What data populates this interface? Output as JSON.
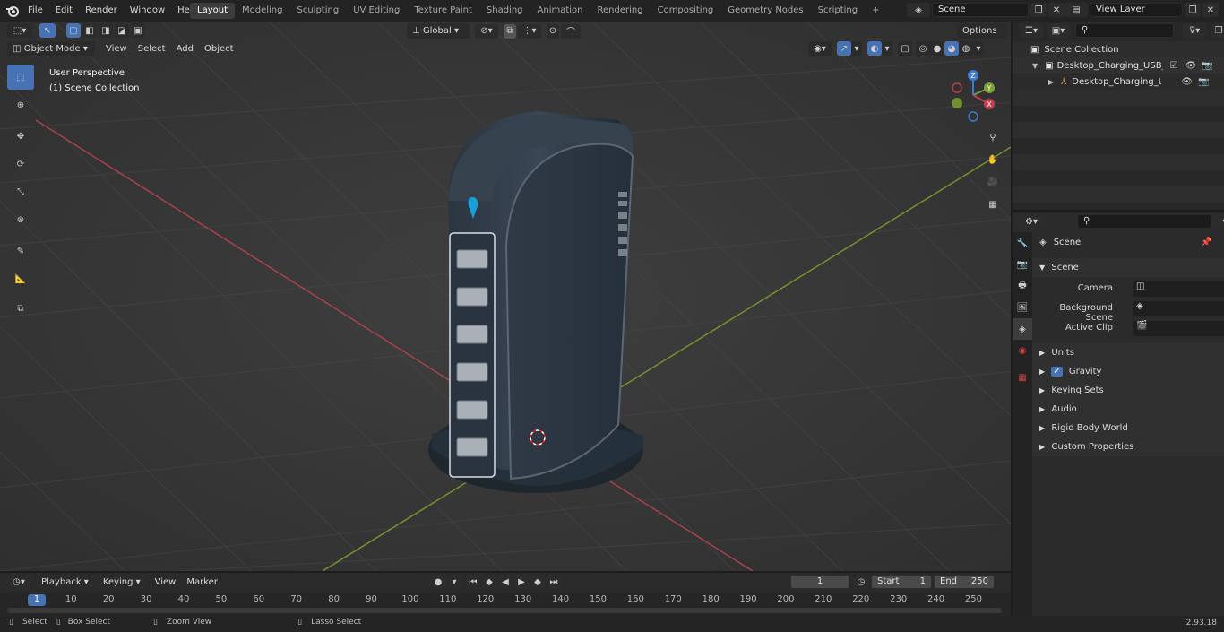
{
  "topbar": {
    "menus": [
      "File",
      "Edit",
      "Render",
      "Window",
      "Help"
    ],
    "workspaces": [
      "Layout",
      "Modeling",
      "Sculpting",
      "UV Editing",
      "Texture Paint",
      "Shading",
      "Animation",
      "Rendering",
      "Compositing",
      "Geometry Nodes",
      "Scripting"
    ],
    "active_workspace": "Layout",
    "scene_name": "Scene",
    "view_layer": "View Layer"
  },
  "viewport": {
    "mode": "Object Mode",
    "menus": [
      "View",
      "Select",
      "Add",
      "Object"
    ],
    "orientation": "Global",
    "options_label": "Options",
    "perspective_label": "User Perspective",
    "collection_label": "(1) Scene Collection",
    "gizmo_axes": [
      "Z",
      "Y",
      "X"
    ]
  },
  "outliner": {
    "root": "Scene Collection",
    "items": [
      {
        "label": "Desktop_Charging_USB_Hub_",
        "indent": 1
      },
      {
        "label": "Desktop_Charging_USB_",
        "indent": 2
      }
    ]
  },
  "properties": {
    "header": "Scene",
    "section": "Scene",
    "fields": [
      {
        "label": "Camera"
      },
      {
        "label": "Background Scene"
      },
      {
        "label": "Active Clip"
      }
    ],
    "panels": [
      "Units",
      "Gravity",
      "Keying Sets",
      "Audio",
      "Rigid Body World",
      "Custom Properties"
    ]
  },
  "timeline": {
    "menus": [
      "Playback",
      "Keying",
      "View",
      "Marker"
    ],
    "current_frame": "1",
    "start_label": "Start",
    "start_value": "1",
    "end_label": "End",
    "end_value": "250",
    "ticks": [
      "1",
      "10",
      "20",
      "30",
      "40",
      "50",
      "60",
      "70",
      "80",
      "90",
      "100",
      "110",
      "120",
      "130",
      "140",
      "150",
      "160",
      "170",
      "180",
      "190",
      "200",
      "210",
      "220",
      "230",
      "240",
      "250"
    ]
  },
  "statusbar": {
    "select": "Select",
    "box_select": "Box Select",
    "zoom_view": "Zoom View",
    "lasso_select": "Lasso Select",
    "version": "2.93.18"
  },
  "colors": {
    "accent": "#4772b3",
    "x_axis": "#c0404f",
    "y_axis": "#7fa033",
    "z_axis": "#3b7bd1"
  }
}
